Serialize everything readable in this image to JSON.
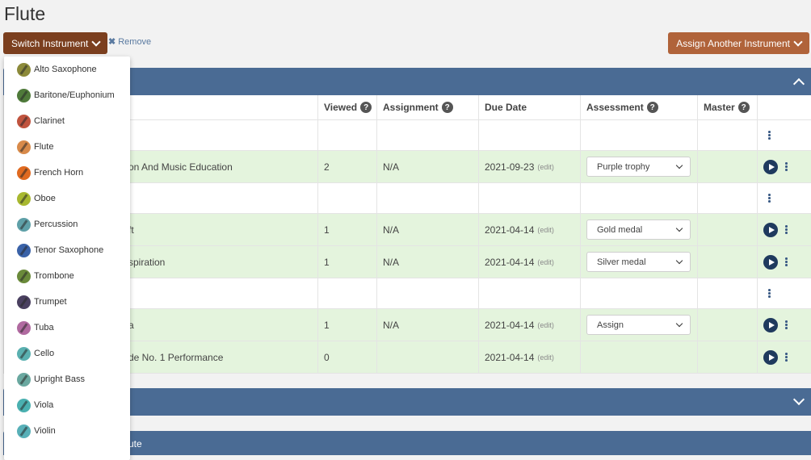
{
  "page_title": "Flute",
  "switch_instrument_label": "Switch Instrument",
  "remove_label": "Remove",
  "assign_another_label": "Assign Another Instrument",
  "panel_3_label": "ute",
  "table": {
    "headers": [
      "",
      "Viewed",
      "Assignment",
      "Due Date",
      "Assessment",
      "Master",
      ""
    ],
    "rows": [
      {
        "title": "",
        "viewed": "",
        "assignment": "",
        "due": "",
        "assessment": "",
        "kind": "white"
      },
      {
        "title": "on And Music Education",
        "viewed": "2",
        "assignment": "N/A",
        "due": "2021-09-23",
        "edit": "(edit)",
        "assessment": "Purple trophy",
        "kind": "green"
      },
      {
        "title": "",
        "viewed": "",
        "assignment": "",
        "due": "",
        "assessment": "",
        "kind": "white"
      },
      {
        "title": "ft",
        "viewed": "1",
        "assignment": "N/A",
        "due": "2021-04-14",
        "edit": "(edit)",
        "assessment": "Gold medal",
        "kind": "green"
      },
      {
        "title": "spiration",
        "viewed": "1",
        "assignment": "N/A",
        "due": "2021-04-14",
        "edit": "(edit)",
        "assessment": "Silver medal",
        "kind": "green"
      },
      {
        "title": "",
        "viewed": "",
        "assignment": "",
        "due": "",
        "assessment": "",
        "kind": "white"
      },
      {
        "title": "a",
        "viewed": "1",
        "assignment": "N/A",
        "due": "2021-04-14",
        "edit": "(edit)",
        "assessment": "Assign",
        "kind": "green"
      },
      {
        "title": "de No. 1 Performance",
        "viewed": "0",
        "assignment": "",
        "due": "2021-04-14",
        "edit": "(edit)",
        "assessment": "",
        "kind": "green"
      }
    ]
  },
  "instruments": [
    {
      "label": "Alto Saxophone",
      "color": "#8c8a3a"
    },
    {
      "label": "Baritone/Euphonium",
      "color": "#4f7a3a"
    },
    {
      "label": "Clarinet",
      "color": "#c0533e"
    },
    {
      "label": "Flute",
      "color": "#d88a4a"
    },
    {
      "label": "French Horn",
      "color": "#e06a20"
    },
    {
      "label": "Oboe",
      "color": "#a8b830"
    },
    {
      "label": "Percussion",
      "color": "#5fa0a8"
    },
    {
      "label": "Tenor Saxophone",
      "color": "#3a62a8"
    },
    {
      "label": "Trombone",
      "color": "#6a8a3a"
    },
    {
      "label": "Trumpet",
      "color": "#4a4060"
    },
    {
      "label": "Tuba",
      "color": "#b06aa0"
    },
    {
      "label": "Cello",
      "color": "#5ab0b0"
    },
    {
      "label": "Upright Bass",
      "color": "#6aa8a0"
    },
    {
      "label": "Viola",
      "color": "#4ab0b0"
    },
    {
      "label": "Violin",
      "color": "#58b0b8"
    }
  ]
}
